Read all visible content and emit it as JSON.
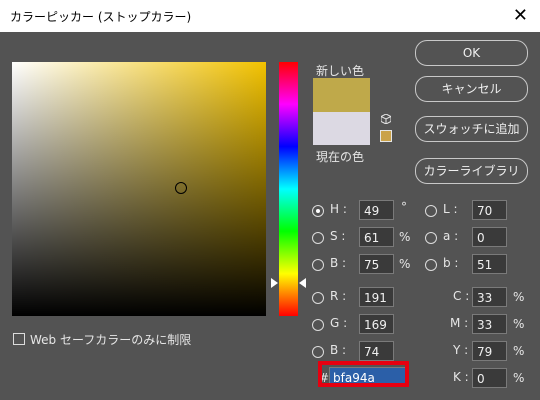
{
  "title": "カラーピッカー (ストップカラー)",
  "labels": {
    "new": "新しい色",
    "current": "現在の色"
  },
  "colors": {
    "new": "#bfa94a",
    "current": "#dcd9e3",
    "picker_base": "#f2c200"
  },
  "buttons": {
    "ok": "OK",
    "cancel": "キャンセル",
    "add_swatch": "スウォッチに追加",
    "library": "カラーライブラリ"
  },
  "fields": {
    "H": {
      "label": "H :",
      "value": "49",
      "unit": "°"
    },
    "S": {
      "label": "S :",
      "value": "61",
      "unit": "%"
    },
    "B": {
      "label": "B :",
      "value": "75",
      "unit": "%"
    },
    "R": {
      "label": "R :",
      "value": "191"
    },
    "G": {
      "label": "G :",
      "value": "169"
    },
    "Bb": {
      "label": "B :",
      "value": "74"
    },
    "L": {
      "label": "L :",
      "value": "70"
    },
    "a": {
      "label": "a :",
      "value": "0"
    },
    "b": {
      "label": "b :",
      "value": "51"
    },
    "C": {
      "label": "C :",
      "value": "33",
      "unit": "%"
    },
    "M": {
      "label": "M :",
      "value": "33",
      "unit": "%"
    },
    "Y": {
      "label": "Y :",
      "value": "79",
      "unit": "%"
    },
    "K": {
      "label": "K :",
      "value": "0",
      "unit": "%"
    }
  },
  "hex": {
    "hash": "#",
    "value": "bfa94a"
  },
  "websafe": {
    "label": "Web セーフカラーのみに制限"
  },
  "icons": {
    "close": "close-icon",
    "cube": "cube-icon",
    "warning": "warning-swatch-icon"
  }
}
